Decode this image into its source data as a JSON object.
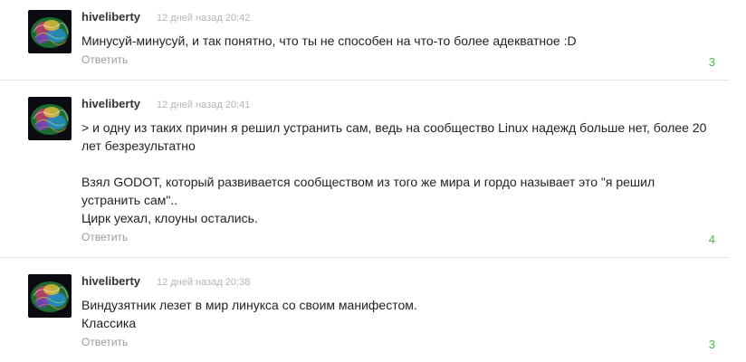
{
  "comments": [
    {
      "author": "hiveliberty",
      "time": "12 дней назад 20:42",
      "text": "Минусуй-минусуй, и так понятно, что ты не способен на что-то более адекватное :D",
      "reply_label": "Ответить",
      "score": "3",
      "avatar_icon": "brain-avatar-icon"
    },
    {
      "author": "hiveliberty",
      "time": "12 дней назад 20:41",
      "paragraphs": [
        "> и одну из таких причин я решил устранить сам, ведь на сообщество Linux надежд больше нет, более 20 лет безрезультатно",
        "Взял GODOT, который развивается сообществом из того же мира и гордо называет это \"я решил устранить сам\"..\nЦирк уехал, клоуны остались."
      ],
      "reply_label": "Ответить",
      "score": "4",
      "avatar_icon": "brain-avatar-icon"
    },
    {
      "author": "hiveliberty",
      "time": "12 дней назад 20:38",
      "text": "Виндузятник лезет в мир линукса со своим манифестом.\nКлассика",
      "reply_label": "Ответить",
      "score": "3",
      "avatar_icon": "brain-avatar-icon"
    }
  ],
  "colors": {
    "score": "#47b84b",
    "time": "#b5b5b5",
    "reply": "#9a9a9a",
    "separator": "#e6e6e6"
  }
}
